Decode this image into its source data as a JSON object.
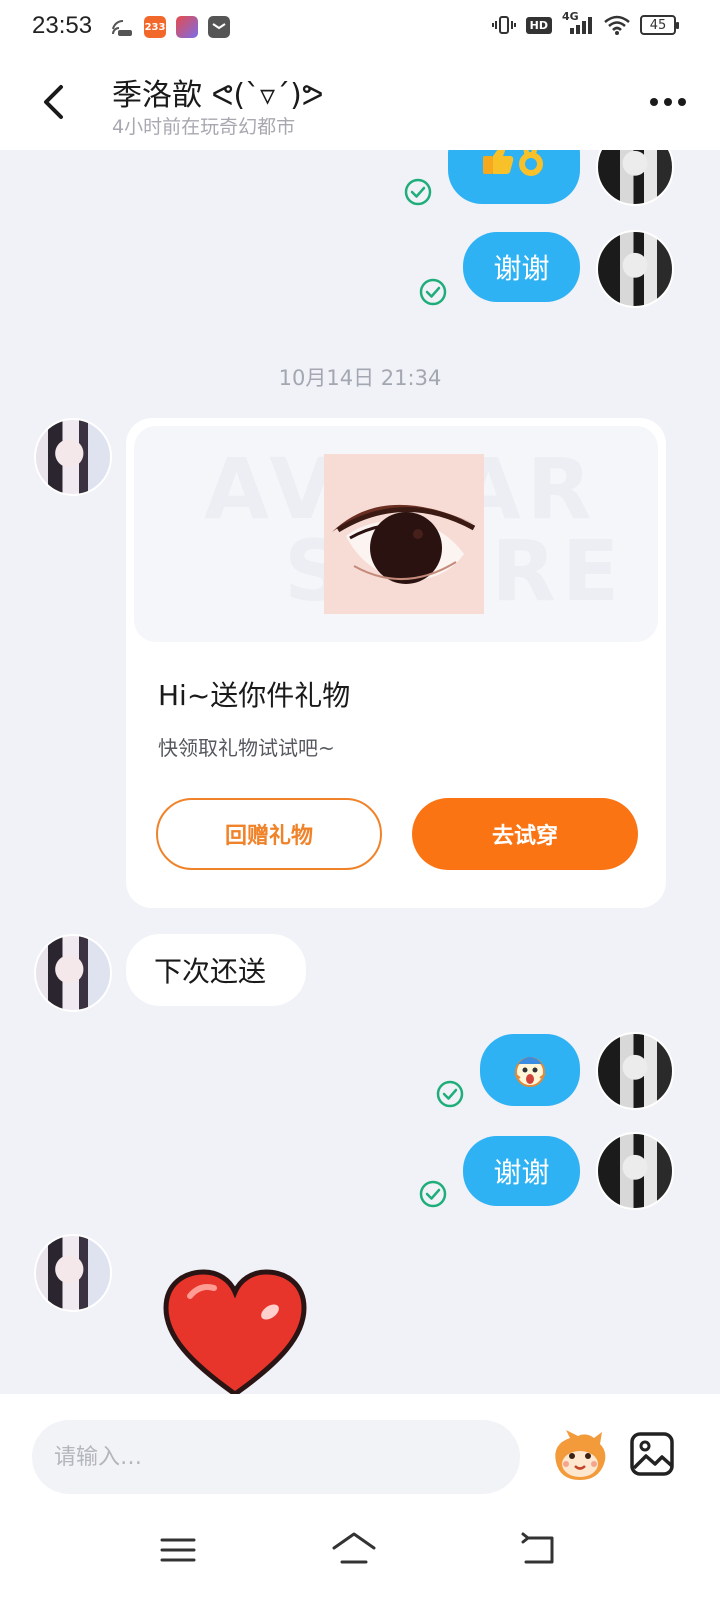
{
  "status_bar": {
    "time": "23:53",
    "app_badge_233": "233",
    "network": "4G",
    "hd": "HD",
    "battery": "45"
  },
  "header": {
    "title": "季洛歆 ᕙ(`▿´)ᕗ",
    "subtitle": "4小时前在玩奇幻都市"
  },
  "messages": {
    "timestamp": "10月14日 21:34",
    "thanks_1": "谢谢",
    "thanks_2": "谢谢",
    "next_time": "下次还送"
  },
  "gift_card": {
    "watermark_top": "AVATAR",
    "watermark_bottom": "STORE",
    "title": "Hi~送你件礼物",
    "description": "快领取礼物试试吧~",
    "return_button": "回赠礼物",
    "try_button": "去试穿"
  },
  "input_bar": {
    "placeholder": "请输入…"
  },
  "colors": {
    "outgoing_bubble": "#2fb2f4",
    "accent_orange": "#fb7414",
    "read_check": "#1fae7a",
    "chat_bg": "#f0f2f7"
  }
}
